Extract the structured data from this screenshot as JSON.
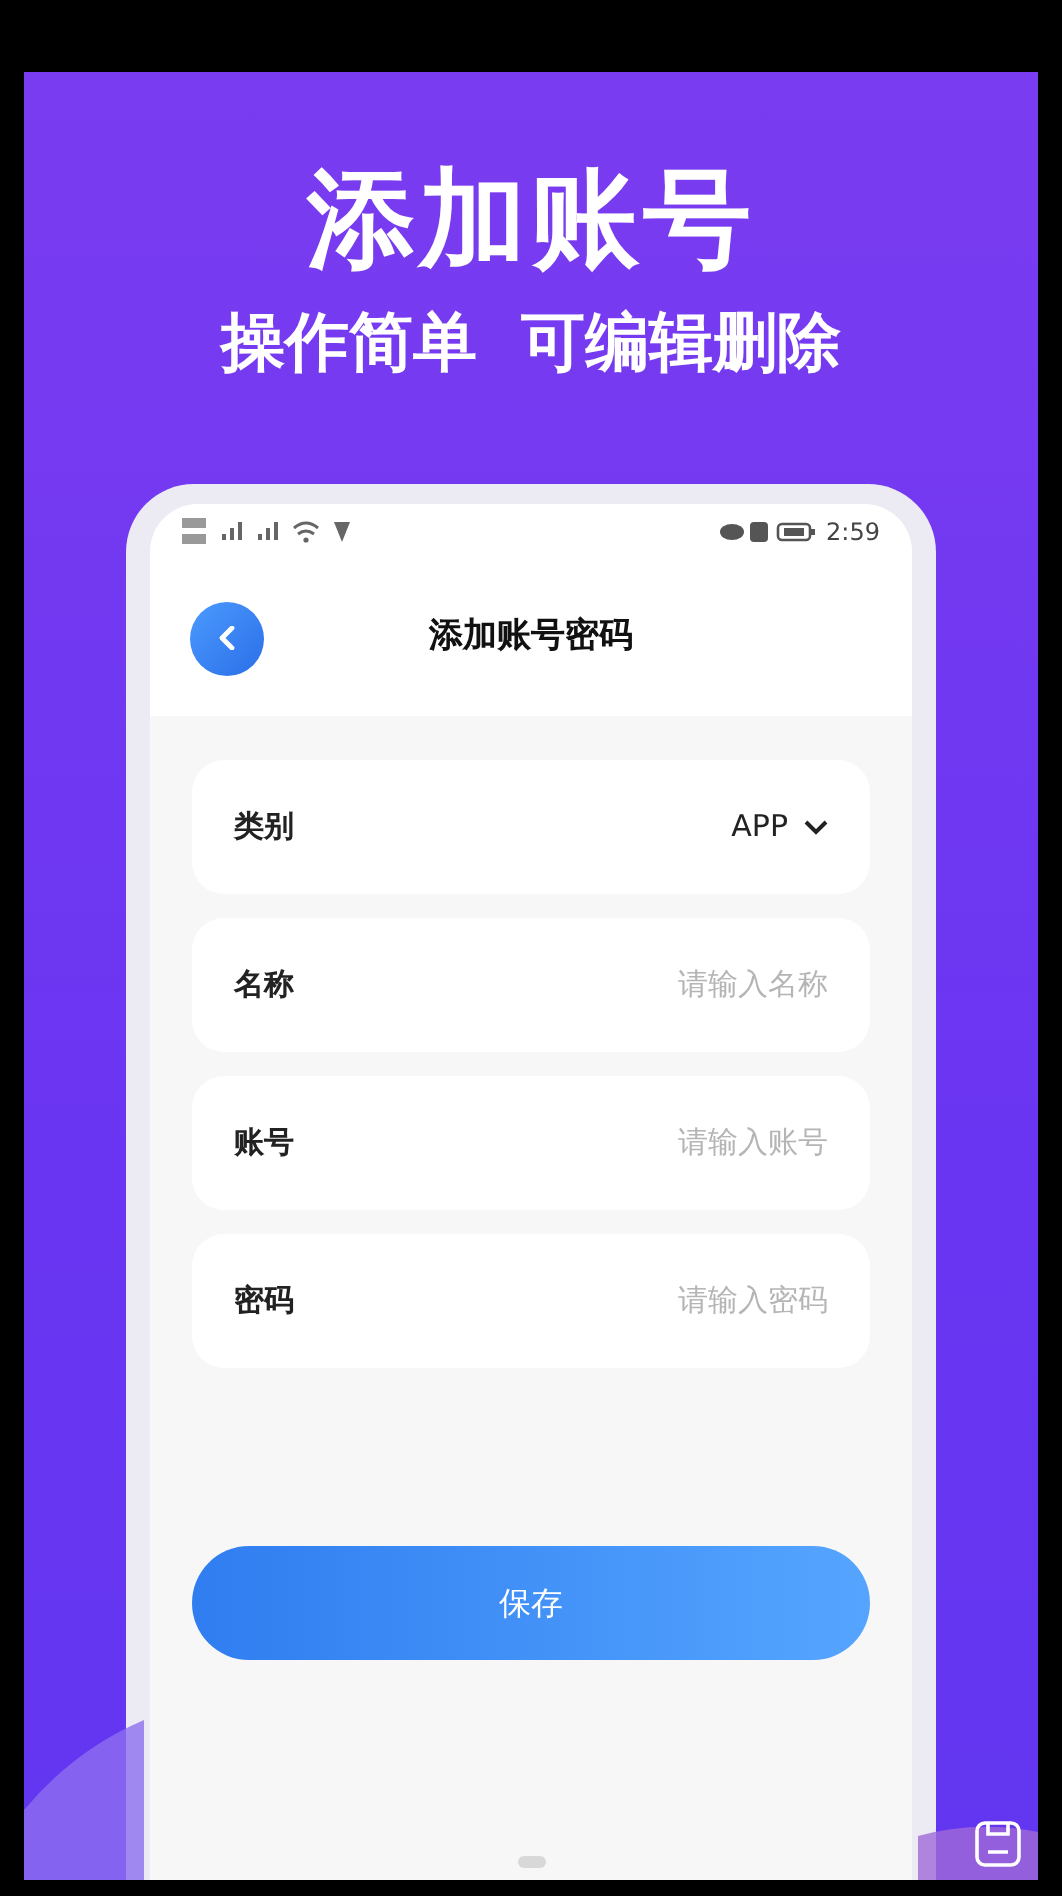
{
  "promo": {
    "headline": "添加账号",
    "tagline": "操作简单  可编辑删除"
  },
  "status_bar": {
    "time": "2:59"
  },
  "header": {
    "title": "添加账号密码"
  },
  "fields": [
    {
      "kind": "select",
      "label": "类别",
      "value": "APP"
    },
    {
      "kind": "input",
      "label": "名称",
      "placeholder": "请输入名称"
    },
    {
      "kind": "input",
      "label": "账号",
      "placeholder": "请输入账号"
    },
    {
      "kind": "input",
      "label": "密码",
      "placeholder": "请输入密码"
    }
  ],
  "save_button": {
    "label": "保存"
  }
}
